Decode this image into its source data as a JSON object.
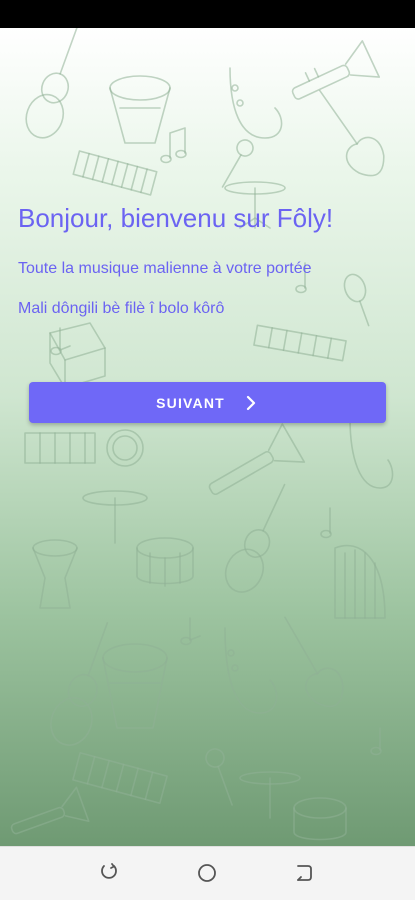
{
  "welcome": {
    "title": "Bonjour, bienvenu sur Fôly!",
    "subtitle_fr": "Toute la musique malienne à votre portée",
    "subtitle_bm": "Mali dôngili bè filè î bolo kôrô"
  },
  "next_button": {
    "label": "SUIVANT",
    "icon": "chevron-right-icon"
  },
  "navigation_bar": {
    "recent_icon": "recent-apps-icon",
    "home_icon": "home-icon",
    "back_icon": "back-icon"
  },
  "colors": {
    "accent": "#6b63f2",
    "button": "#6f68f7",
    "gradient_top": "#ffffff",
    "gradient_bottom": "#6f9a73",
    "status_bar": "#000000"
  }
}
